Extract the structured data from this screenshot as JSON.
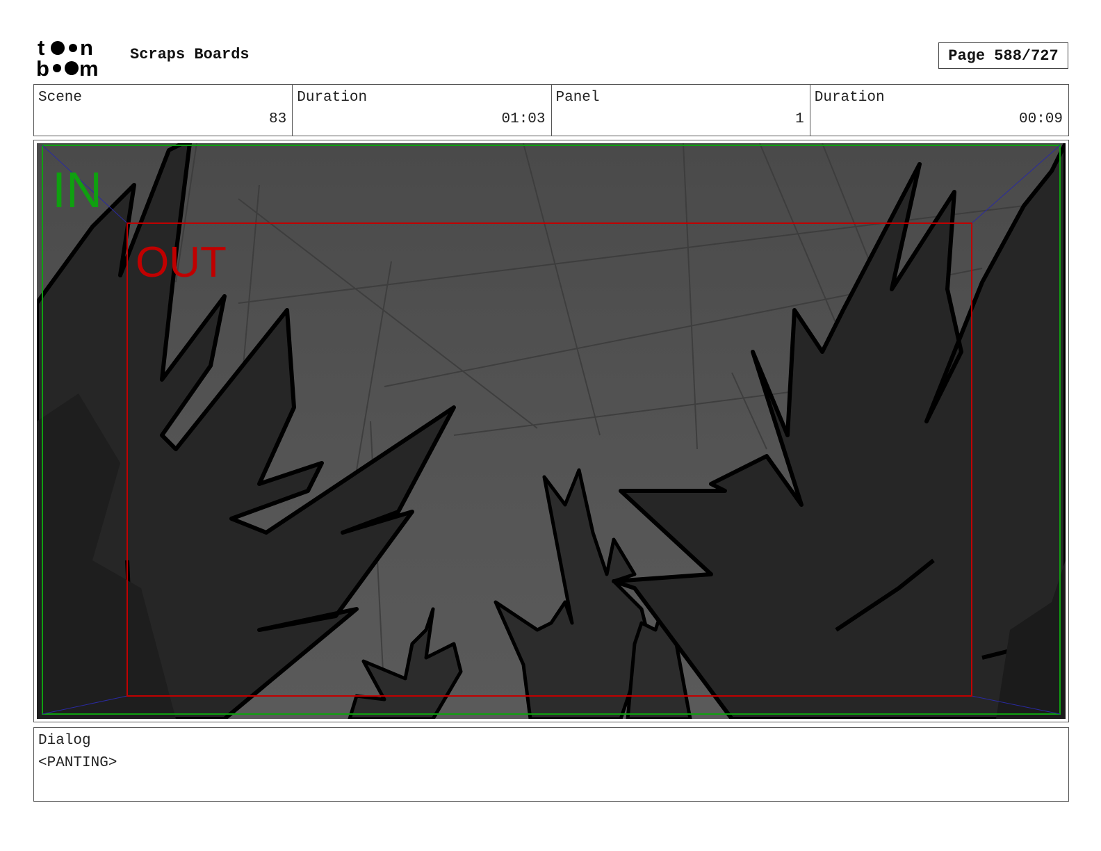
{
  "header": {
    "logo_text": "toonboom",
    "project_title": "Scraps Boards",
    "page_indicator": "Page 588/727"
  },
  "info": {
    "scene_label": "Scene",
    "scene_value": "83",
    "scene_duration_label": "Duration",
    "scene_duration_value": "01:03",
    "panel_label": "Panel",
    "panel_value": "1",
    "panel_duration_label": "Duration",
    "panel_duration_value": "00:09"
  },
  "panel": {
    "in_label": "IN",
    "out_label": "OUT",
    "in_color": "#0fa010",
    "out_color": "#c00000"
  },
  "dialog": {
    "label": "Dialog",
    "text": "<PANTING>"
  }
}
